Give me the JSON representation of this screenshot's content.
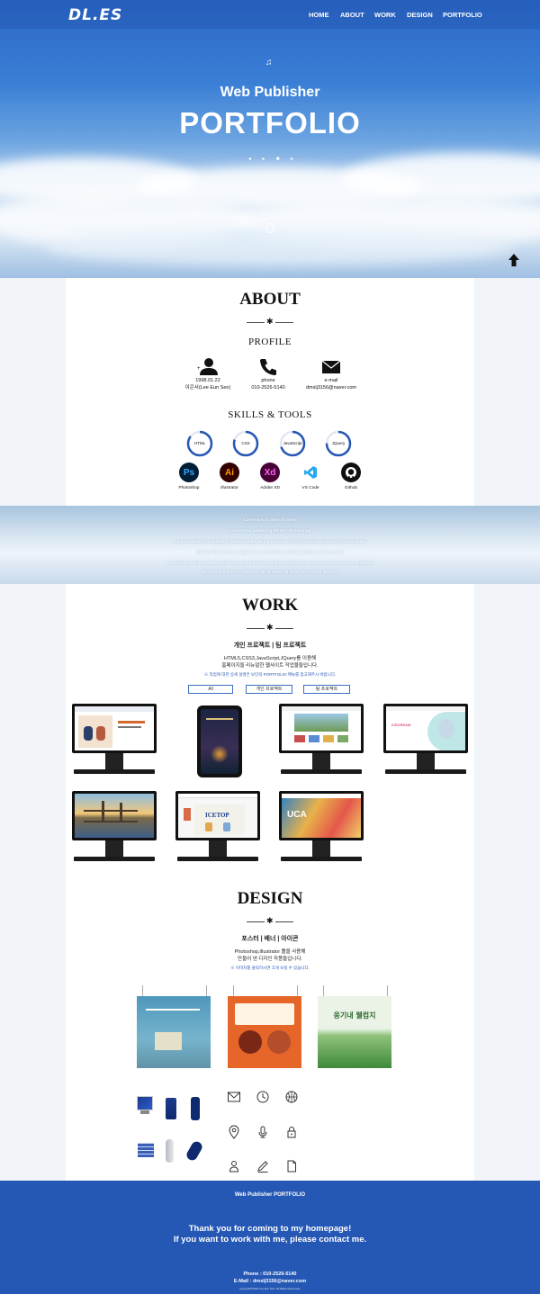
{
  "nav": {
    "logo": "DL.ES",
    "items": [
      "HOME",
      "ABOUT",
      "WORK",
      "DESIGN",
      "PORTFOLIO"
    ]
  },
  "hero": {
    "subtitle": "Web Publisher",
    "title": "PORTFOLIO"
  },
  "about": {
    "title": "ABOUT",
    "profile_title": "PROFILE",
    "profile": [
      {
        "line1": "1998.01.22",
        "line2": "이은서(Lee Eun Seo)"
      },
      {
        "line1": "phone",
        "line2": "010-2526-5140"
      },
      {
        "line1": "e-mail",
        "line2": "dmslj3156@naver.com"
      }
    ],
    "skills_title": "SKILLS & TOOLS",
    "skills": [
      {
        "name": "HTML",
        "level": 0.85
      },
      {
        "name": "CSS",
        "level": 0.8
      },
      {
        "name": "JavaScript",
        "level": 0.7
      },
      {
        "name": "JQuery",
        "level": 0.75
      }
    ],
    "tools": [
      {
        "abbr": "Ps",
        "name": "Photoshop",
        "color": "#31a8ff",
        "bg": "#001e36"
      },
      {
        "abbr": "Ai",
        "name": "Illustrator",
        "color": "#ff9a00",
        "bg": "#330000"
      },
      {
        "abbr": "Xd",
        "name": "Adobe XD",
        "color": "#ff61f6",
        "bg": "#470137"
      },
      {
        "abbr": "",
        "name": "VS Code",
        "color": "#23a9f2",
        "bg": "#ffffff"
      },
      {
        "abbr": "",
        "name": "Github",
        "color": "#ffffff",
        "bg": "#111111"
      }
    ]
  },
  "sky_band": {
    "lines": [
      "\"Lorem ipsum dolor sit amet\"",
      "consectetur adipiscing elit sed do eiusmod",
      "tempor incididunt ut labore et dolore magna aliqua ut enim ad minim veniam quis nostrud exercitation",
      "ullamco laboris nisi ut aliquip ex ea commodo consequat duis aute irure dolor",
      "in reprehenderit in voluptate velit esse cillum dolore eu fugiat nulla pariatur excepteur sint occaecat cupidatat",
      "non proident sunt in culpa qui officia deserunt mollit anim id est laborum"
    ]
  },
  "work": {
    "title": "WORK",
    "heading": "개인 프로젝트 | 팀 프로젝트",
    "desc1": "HTML5,CSS3,JavaScript,JQuery를 이용해",
    "desc2": "홈페이지들 리뉴얼한 웹사이트 작업물들입니다.",
    "note": "※ 작업에 대한 상세 설명은 보단의 PORTFOLIO 메뉴를 참고해주시 바랍니다.",
    "filters": [
      "All",
      "개인 프로젝트",
      "팀 프로젝트"
    ],
    "project_labels": [
      "ICECREAM",
      "ICETOP",
      "UCA"
    ]
  },
  "design": {
    "title": "DESIGN",
    "heading": "포스터 | 배너 | 아이콘",
    "desc1": "Photoshop,Illustrator 툴을 사용해",
    "desc2": "만들어 낸 디자인 작품들입니다.",
    "note": "※ 이미지를 클릭하시면 크게 보실 수 있습니다.",
    "poster3_title": "웅기내 웰컴지"
  },
  "footer": {
    "title": "Web Publisher PORTFOLIO",
    "msg1": "Thank you for coming to my homepage!",
    "msg2": "If you want to work with me, please contact me.",
    "phone": "Phone : 010-2526-5140",
    "email": "E-Mail : dmslj3156@naver.com",
    "copy": "copyright©2023 Lee Eun Seo. All Rights Reserved."
  }
}
